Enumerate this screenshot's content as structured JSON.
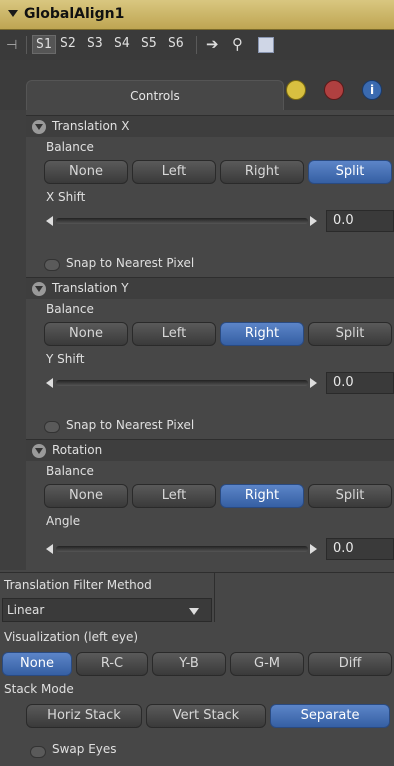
{
  "header": {
    "title": "GlobalAlign1"
  },
  "toolbar": {
    "slots": [
      "S1",
      "S2",
      "S3",
      "S4",
      "S5",
      "S6"
    ]
  },
  "tabs": {
    "controls": "Controls"
  },
  "translation_x": {
    "title": "Translation X",
    "balance_label": "Balance",
    "buttons": [
      "None",
      "Left",
      "Right",
      "Split"
    ],
    "selected": "Split",
    "shift_label": "X Shift",
    "value": "0.0",
    "snap_label": "Snap to Nearest Pixel"
  },
  "translation_y": {
    "title": "Translation Y",
    "balance_label": "Balance",
    "buttons": [
      "None",
      "Left",
      "Right",
      "Split"
    ],
    "selected": "Right",
    "shift_label": "Y Shift",
    "value": "0.0",
    "snap_label": "Snap to Nearest Pixel"
  },
  "rotation": {
    "title": "Rotation",
    "balance_label": "Balance",
    "buttons": [
      "None",
      "Left",
      "Right",
      "Split"
    ],
    "selected": "Right",
    "angle_label": "Angle",
    "value": "0.0"
  },
  "filter": {
    "label": "Translation Filter Method",
    "value": "Linear"
  },
  "visualization": {
    "label": "Visualization (left eye)",
    "buttons": [
      "None",
      "R-C",
      "Y-B",
      "G-M",
      "Diff"
    ],
    "selected": "None"
  },
  "stack": {
    "label": "Stack Mode",
    "buttons": [
      "Horiz Stack",
      "Vert Stack",
      "Separate"
    ],
    "selected": "Separate"
  },
  "swap": {
    "label": "Swap Eyes"
  },
  "colors": {
    "header": "#c8b464",
    "accent": "#4a72b8"
  }
}
